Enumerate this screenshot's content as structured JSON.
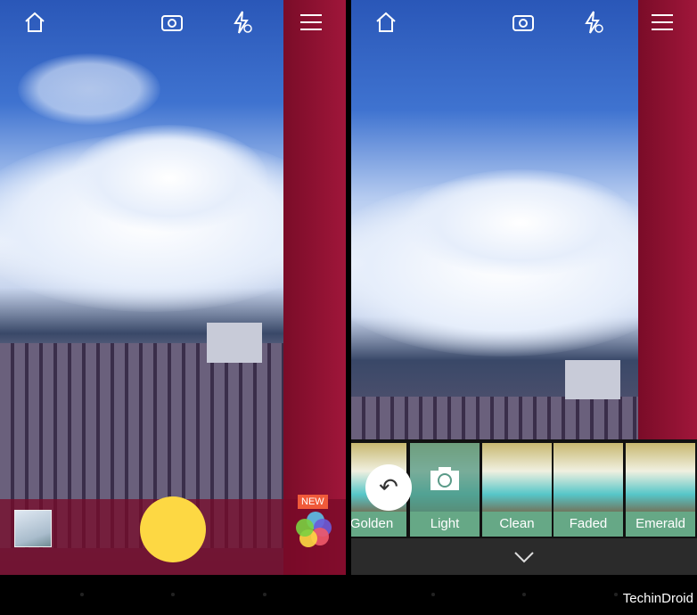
{
  "left_screen": {
    "toolbar": {
      "icons": [
        "home-icon",
        "switch-camera-icon",
        "flash-off-icon",
        "menu-icon"
      ]
    },
    "new_badge": "NEW",
    "shutter_color": "#fdd843"
  },
  "right_screen": {
    "toolbar": {
      "icons": [
        "home-icon",
        "switch-camera-icon",
        "flash-off-icon",
        "menu-icon"
      ]
    },
    "filters": [
      {
        "label": "Golden"
      },
      {
        "label": "Light",
        "selected": true
      },
      {
        "label": "Clean"
      },
      {
        "label": "Faded"
      },
      {
        "label": "Emerald"
      }
    ],
    "filter_label_color": "#66a886"
  },
  "watermark": "TechinDroid"
}
